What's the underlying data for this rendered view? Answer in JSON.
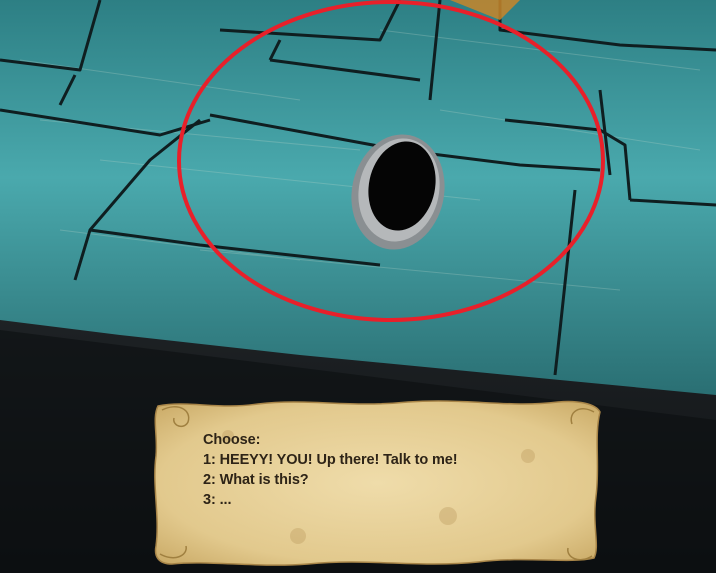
{
  "scene": {
    "highlight_color": "#e8202a",
    "wall_color": "#3fa0a6",
    "hole_color": "#050505"
  },
  "dialog": {
    "prompt": "Choose:",
    "options": [
      {
        "label": "1: HEEYY! YOU! Up there! Talk to me!"
      },
      {
        "label": "2: What is this?"
      },
      {
        "label": "3: ..."
      }
    ],
    "text_color": "#2e2417",
    "parchment_color": "#e6cf95"
  }
}
